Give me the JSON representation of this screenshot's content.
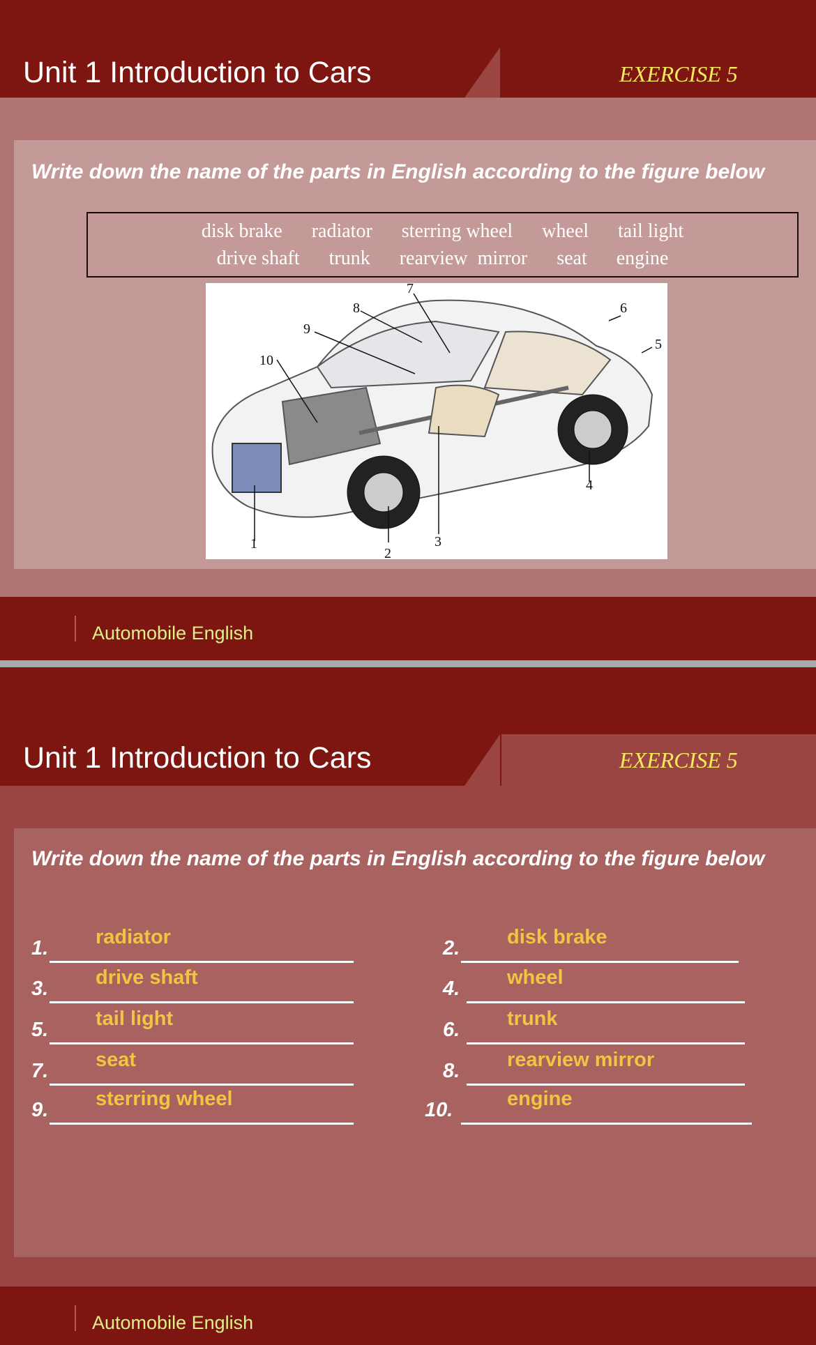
{
  "slides": [
    {
      "header": {
        "title": "Unit 1 Introduction to Cars",
        "exercise": "EXERCISE 5"
      },
      "instruction": "Write down the name of the parts in English according to the figure below",
      "word_bank": {
        "row1": [
          "disk brake",
          "radiator",
          "sterring wheel",
          "wheel",
          "tail light"
        ],
        "row2": [
          "drive shaft",
          "trunk",
          "rearview  mirror",
          "seat",
          "engine"
        ]
      },
      "figure": {
        "callouts": [
          "1",
          "2",
          "3",
          "4",
          "5",
          "6",
          "7",
          "8",
          "9",
          "10"
        ]
      },
      "footer": {
        "text": "Automobile English"
      }
    },
    {
      "header": {
        "title": "Unit 1 Introduction to Cars",
        "exercise": "EXERCISE 5"
      },
      "instruction": "Write down the name of the parts in English according to the figure below",
      "answers": [
        {
          "num": "1.",
          "answer": "radiator"
        },
        {
          "num": "2.",
          "answer": "disk brake"
        },
        {
          "num": "3.",
          "answer": "drive shaft"
        },
        {
          "num": "4.",
          "answer": "wheel"
        },
        {
          "num": "5.",
          "answer": "tail light"
        },
        {
          "num": "6.",
          "answer": "trunk"
        },
        {
          "num": "7.",
          "answer": "seat"
        },
        {
          "num": "8.",
          "answer": "rearview mirror"
        },
        {
          "num": "9.",
          "answer": "sterring wheel"
        },
        {
          "num": "10.",
          "answer": "engine"
        }
      ],
      "footer": {
        "text": "Automobile English"
      }
    }
  ],
  "colors": {
    "header_dark": "#7d1610",
    "exercise_yellow": "#f7ea5c",
    "answer_yellow": "#f2c443",
    "footer_text": "#dff08a"
  }
}
